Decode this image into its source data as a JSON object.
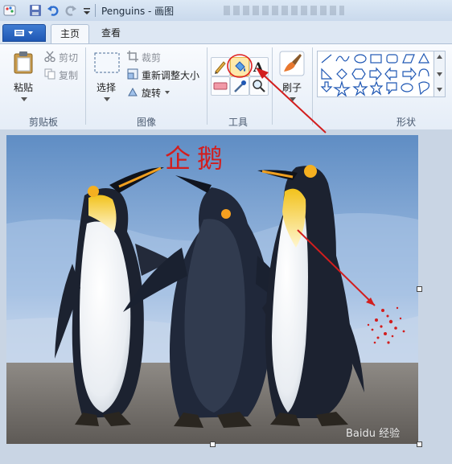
{
  "window": {
    "title": "Penguins - 画图"
  },
  "tabs": [
    {
      "label": "主页"
    },
    {
      "label": "查看"
    }
  ],
  "clipboard": {
    "paste": "粘贴",
    "cut": "剪切",
    "copy": "复制",
    "group": "剪贴板"
  },
  "image": {
    "select": "选择",
    "crop": "裁剪",
    "resize": "重新调整大小",
    "rotate": "旋转",
    "group": "图像"
  },
  "tools": {
    "group": "工具"
  },
  "brushes": {
    "label": "刷子"
  },
  "shapes": {
    "group": "形状"
  },
  "annotation": {
    "text": "企鹅"
  },
  "watermark": {
    "text": "Baidu 经验"
  },
  "colors": {
    "accent": "#1f57b4",
    "annotation_red": "#d21e1e"
  }
}
